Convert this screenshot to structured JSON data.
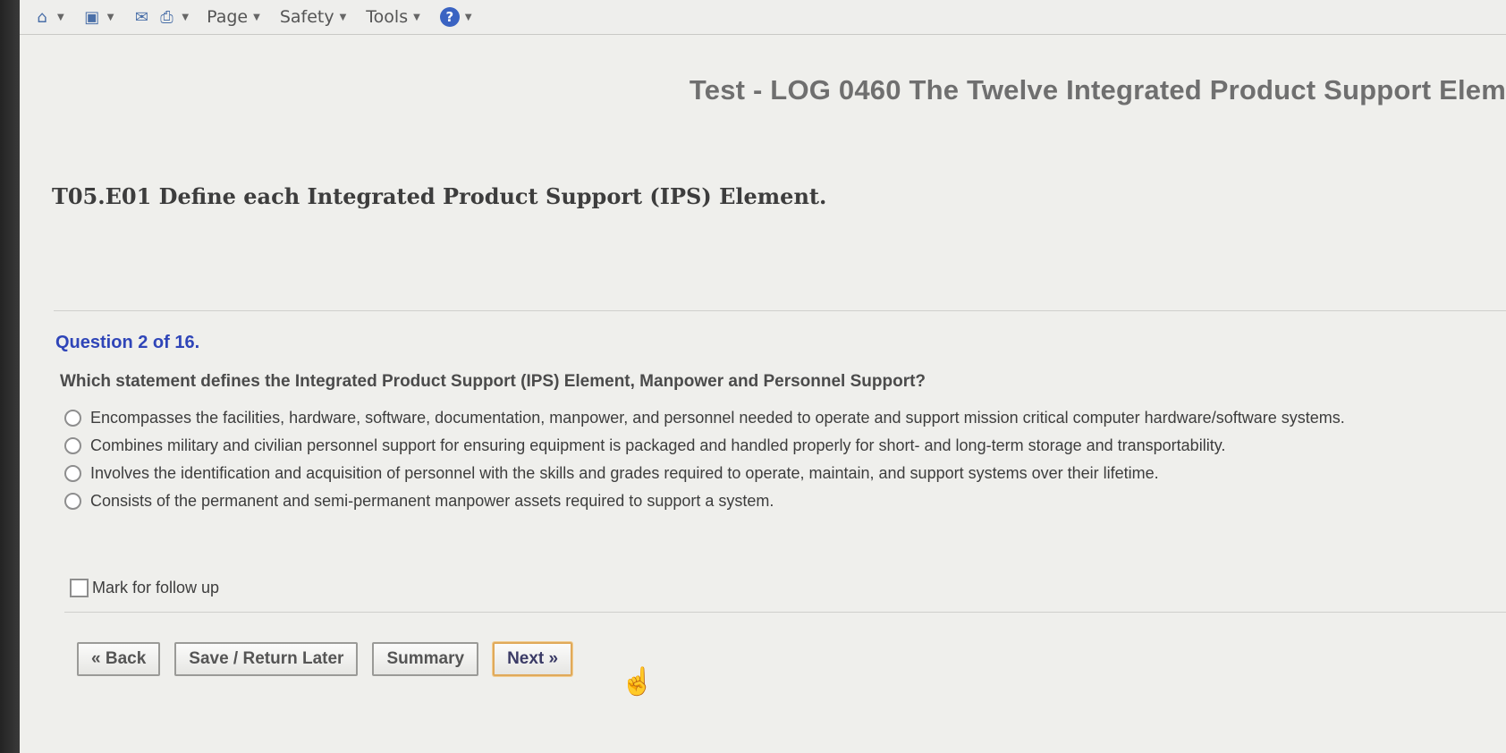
{
  "toolbar": {
    "icons": [
      "home-icon",
      "feed-icon",
      "mail-icon",
      "print-icon",
      "help-icon"
    ],
    "menus": [
      "Page",
      "Safety",
      "Tools"
    ]
  },
  "test": {
    "title": "Test - LOG 0460 The Twelve Integrated Product Support Elem"
  },
  "objective": "T05.E01 Define each Integrated Product Support (IPS) Element.",
  "question": {
    "number_label": "Question 2 of 16.",
    "text": "Which statement defines the Integrated Product Support (IPS) Element, Manpower and Personnel Support?",
    "options": [
      "Encompasses the facilities, hardware, software, documentation, manpower, and personnel needed to operate and support mission critical computer hardware/software systems.",
      "Combines military and civilian personnel support for ensuring equipment is packaged and handled properly for short- and long-term storage and transportability.",
      "Involves the identification and acquisition of personnel with the skills and grades required to operate, maintain, and support systems over their lifetime.",
      "Consists of the permanent and semi-permanent manpower assets required to support a system."
    ],
    "selected_option": null,
    "follow_up_label": "Mark for follow up",
    "follow_up_checked": false
  },
  "buttons": {
    "back": "« Back",
    "save_return": "Save / Return Later",
    "summary": "Summary",
    "next": "Next »"
  }
}
